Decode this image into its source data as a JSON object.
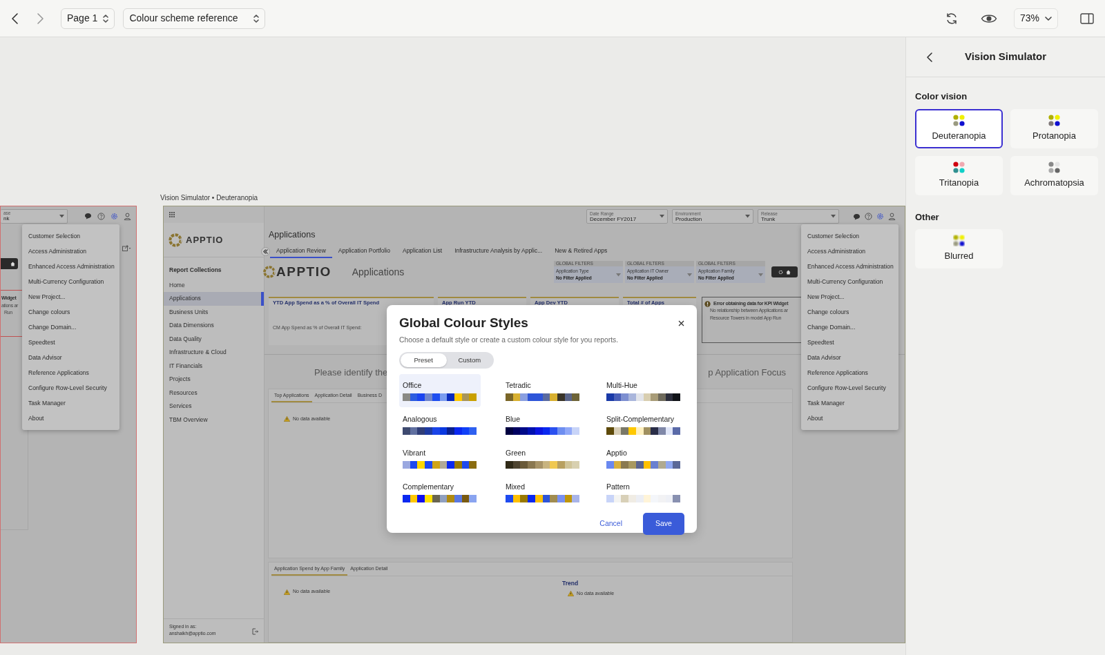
{
  "toolbar": {
    "page": "Page 1",
    "document": "Colour scheme reference",
    "zoom": "73%"
  },
  "left_frame": {
    "select_label": "ase",
    "select_value": "nk",
    "fragments": [
      "Widget",
      "ations ar",
      "Run"
    ],
    "menu": [
      "Customer Selection",
      "Access Administration",
      "Enhanced Access Administration",
      "Multi-Currency Configuration",
      "New Project...",
      "Change colours",
      "Change Domain...",
      "Speedtest",
      "Data Advisor",
      "Reference Applications",
      "Configure Row-Level Security",
      "Task Manager",
      "About"
    ]
  },
  "frame_label": "Vision Simulator • Deuteranopia",
  "app": {
    "sidebar": {
      "logo": "APPTIO",
      "heading": "Report Collections",
      "items": [
        {
          "label": "Home",
          "selected": false
        },
        {
          "label": "Applications",
          "selected": true
        },
        {
          "label": "Business Units",
          "selected": false
        },
        {
          "label": "Data Dimensions",
          "selected": false
        },
        {
          "label": "Data Quality",
          "selected": false
        },
        {
          "label": "Infrastructure & Cloud",
          "selected": false
        },
        {
          "label": "IT Financials",
          "selected": false
        },
        {
          "label": "Projects",
          "selected": false
        },
        {
          "label": "Resources",
          "selected": false
        },
        {
          "label": "Services",
          "selected": false
        },
        {
          "label": "TBM Overview",
          "selected": false
        }
      ],
      "signed_in_label": "Signed in as:",
      "user": "anshaikh@apptio.com"
    },
    "selects": [
      {
        "label": "Date Range",
        "value": "December FY2017"
      },
      {
        "label": "Environment",
        "value": "Production"
      },
      {
        "label": "Release",
        "value": "Trunk"
      }
    ],
    "title": "Applications",
    "tabs": [
      {
        "label": "Application Review",
        "selected": true
      },
      {
        "label": "Application Portfolio",
        "selected": false
      },
      {
        "label": "Application List",
        "selected": false
      },
      {
        "label": "Infrastructure Analysis by Applic...",
        "selected": false
      },
      {
        "label": "New & Retired Apps",
        "selected": false
      }
    ],
    "banner": {
      "logo": "APPTIO",
      "title": "Applications"
    },
    "filters": [
      {
        "heading": "GLOBAL FILTERS",
        "label": "Application Type",
        "value": "No Filter Applied"
      },
      {
        "heading": "GLOBAL FILTERS",
        "label": "Application IT Owner",
        "value": "No Filter Applied"
      },
      {
        "heading": "GLOBAL FILTERS",
        "label": "Application Family",
        "value": "No Filter Applied"
      }
    ],
    "widgets": [
      {
        "title": "YTD App Spend as a % of Overall IT Spend",
        "note": "CM App Spend as % of Overall IT Spend:"
      },
      {
        "title": "App Run YTD"
      },
      {
        "title": "App Dev YTD"
      },
      {
        "title": "Total # of Apps"
      }
    ],
    "error": {
      "title": "Error obtaining data for KPI Widget",
      "lines": [
        "No relationship between Applications ar",
        "Resource Towers in model App Run"
      ]
    },
    "focus_fragments": [
      "Please identify the",
      "p Application Focus"
    ],
    "lower_tabs": [
      {
        "label": "Top Applications",
        "selected": true
      },
      {
        "label": "Application Detail",
        "selected": false
      },
      {
        "label": "Business D",
        "selected": false
      }
    ],
    "lower_no_data": "No data available",
    "bottom_tabs": [
      {
        "label": "Application Spend by App Family",
        "selected": true
      },
      {
        "label": "Application Detail",
        "selected": false
      }
    ],
    "bottom_no_data": "No data available",
    "trend_title": "Trend",
    "trend_no_data": "No data available",
    "menu": [
      "Customer Selection",
      "Access Administration",
      "Enhanced Access Administration",
      "Multi-Currency Configuration",
      "New Project...",
      "Change colours",
      "Change Domain...",
      "Speedtest",
      "Data Advisor",
      "Reference Applications",
      "Configure Row-Level Security",
      "Task Manager",
      "About"
    ]
  },
  "dialog": {
    "title": "Global Colour Styles",
    "subtitle": "Choose a default style or create a custom colour style for you reports.",
    "modes": [
      {
        "label": "Preset",
        "selected": true
      },
      {
        "label": "Custom",
        "selected": false
      }
    ],
    "styles": [
      {
        "name": "Office",
        "selected": true,
        "swatches": [
          {
            "color": "#8a8a85"
          },
          {
            "color": "#2b5be0"
          },
          {
            "color": "#1a44f0"
          },
          {
            "color": "#6f85cc"
          },
          {
            "color": "#1e4ef0"
          },
          {
            "color": "#7a9cf0"
          },
          {
            "color": "#0a2bbf"
          },
          {
            "color": "#ffc800"
          },
          {
            "color": "#a8955a"
          },
          {
            "color": "#c9a000"
          }
        ]
      },
      {
        "name": "Tetradic",
        "selected": false,
        "swatches": [
          {
            "color": "#7a6628"
          },
          {
            "color": "#d8b030"
          },
          {
            "color": "#8a9fe0"
          },
          {
            "color": "#2e55d8"
          },
          {
            "color": "#2e55d9"
          },
          {
            "color": "#5a6aa0"
          },
          {
            "color": "#d8b030"
          },
          {
            "color": "#3a3428"
          },
          {
            "color": "#5a6488"
          },
          {
            "color": "#6e6438"
          }
        ]
      },
      {
        "name": "Multi-Hue",
        "selected": false,
        "swatches": [
          {
            "color": "#1a3aa8"
          },
          {
            "color": "#4a60b8"
          },
          {
            "color": "#7d8fd0"
          },
          {
            "color": "#aab6dc"
          },
          {
            "color": "#e2e4ea"
          },
          {
            "color": "#d8ceb0"
          },
          {
            "color": "#a89c78"
          },
          {
            "color": "#6e6a5c"
          },
          {
            "color": "#2c2e3c"
          },
          {
            "color": "#111318"
          }
        ]
      },
      {
        "name": "Analogous",
        "selected": false,
        "swatches": [
          {
            "color": "#3e4a70"
          },
          {
            "color": "#6070a0"
          },
          {
            "color": "#303e78"
          },
          {
            "color": "#1e3aa0"
          },
          {
            "color": "#1a44e8"
          },
          {
            "color": "#0a38e0"
          },
          {
            "color": "#0a2090"
          },
          {
            "color": "#0a28f0"
          },
          {
            "color": "#1040f8"
          },
          {
            "color": "#2e60f0"
          }
        ]
      },
      {
        "name": "Blue",
        "selected": false,
        "swatches": [
          {
            "color": "#000040"
          },
          {
            "color": "#000060"
          },
          {
            "color": "#000a88"
          },
          {
            "color": "#0010b0"
          },
          {
            "color": "#0a14e0"
          },
          {
            "color": "#0a28f0"
          },
          {
            "color": "#2a50f0"
          },
          {
            "color": "#6e8ef0"
          },
          {
            "color": "#90a8f8"
          },
          {
            "color": "#c8d4f8"
          }
        ]
      },
      {
        "name": "Split-Complementary",
        "selected": false,
        "swatches": [
          {
            "color": "#5e4a0a"
          },
          {
            "color": "#d8cfb8"
          },
          {
            "color": "#7a7868"
          },
          {
            "color": "#ffc800"
          },
          {
            "color": "#fff0c0"
          },
          {
            "color": "#a09060"
          },
          {
            "color": "#2a2e48"
          },
          {
            "color": "#8088a8"
          },
          {
            "color": "#e0e6f8"
          },
          {
            "color": "#5a6aa8"
          }
        ]
      },
      {
        "name": "Vibrant",
        "selected": false,
        "swatches": [
          {
            "color": "#9aa8e0"
          },
          {
            "color": "#1e4af0"
          },
          {
            "color": "#ffd800"
          },
          {
            "color": "#1e4af0"
          },
          {
            "color": "#d0a418"
          },
          {
            "color": "#b0aa98"
          },
          {
            "color": "#0a28f0"
          },
          {
            "color": "#9a7a00"
          },
          {
            "color": "#1e4af0"
          },
          {
            "color": "#8a6c10"
          }
        ]
      },
      {
        "name": "Green",
        "selected": false,
        "swatches": [
          {
            "color": "#302a18"
          },
          {
            "color": "#4e4430"
          },
          {
            "color": "#6a5a38"
          },
          {
            "color": "#8a7850"
          },
          {
            "color": "#a89468"
          },
          {
            "color": "#c8b480"
          },
          {
            "color": "#f0c850"
          },
          {
            "color": "#b8a060"
          },
          {
            "color": "#d0c498"
          },
          {
            "color": "#d8d0b0"
          }
        ]
      },
      {
        "name": "Apptio",
        "selected": false,
        "swatches": [
          {
            "color": "#6a88f0"
          },
          {
            "color": "#d8b040"
          },
          {
            "color": "#8a7a50"
          },
          {
            "color": "#a89860"
          },
          {
            "color": "#5a6490"
          },
          {
            "color": "#ffc000"
          },
          {
            "color": "#6a80d0"
          },
          {
            "color": "#b0aa90"
          },
          {
            "color": "#90a8f0"
          },
          {
            "color": "#5a6898"
          }
        ]
      },
      {
        "name": "Complementary",
        "selected": false,
        "swatches": [
          {
            "color": "#0a28f0"
          },
          {
            "color": "#ffc800"
          },
          {
            "color": "#1010f0"
          },
          {
            "color": "#ffe000"
          },
          {
            "color": "#6a6650"
          },
          {
            "color": "#90a0c0"
          },
          {
            "color": "#b08a10"
          },
          {
            "color": "#5a78e0"
          },
          {
            "color": "#7a5a10"
          },
          {
            "color": "#8aa4f0"
          }
        ]
      },
      {
        "name": "Mixed",
        "selected": false,
        "swatches": [
          {
            "color": "#1e4af0"
          },
          {
            "color": "#ffc000"
          },
          {
            "color": "#9a7a00"
          },
          {
            "color": "#0a28f0"
          },
          {
            "color": "#ffc000"
          },
          {
            "color": "#2e55d8"
          },
          {
            "color": "#a08c50"
          },
          {
            "color": "#7890f0"
          },
          {
            "color": "#c0960a"
          },
          {
            "color": "#a8b4e8"
          }
        ]
      },
      {
        "name": "Pattern",
        "selected": false,
        "swatches": [
          {
            "color": "#c8d4f8"
          },
          {
            "color": "#f4f4f2"
          },
          {
            "color": "#d8d0b8"
          },
          {
            "color": "#f0ece4"
          },
          {
            "color": "#eceef4"
          },
          {
            "color": "#fff4d8"
          },
          {
            "color": "#f4f6fa"
          },
          {
            "color": "#f2f2f4"
          },
          {
            "color": "#eef0f6"
          },
          {
            "color": "#8890b0"
          }
        ]
      }
    ],
    "cancel": "Cancel",
    "save": "Save"
  },
  "vision_panel": {
    "title": "Vision Simulator",
    "sections": [
      {
        "heading": "Color vision",
        "options": [
          {
            "label": "Deuteranopia",
            "selected": true,
            "kind": "sharp"
          },
          {
            "label": "Protanopia",
            "selected": false,
            "kind": "sharp"
          },
          {
            "label": "Tritanopia",
            "selected": false,
            "kind": "sharp"
          },
          {
            "label": "Achromatopsia",
            "selected": false,
            "kind": "sharp"
          }
        ]
      },
      {
        "heading": "Other",
        "options": [
          {
            "label": "Blurred",
            "selected": false,
            "kind": "blurred"
          }
        ]
      }
    ]
  }
}
